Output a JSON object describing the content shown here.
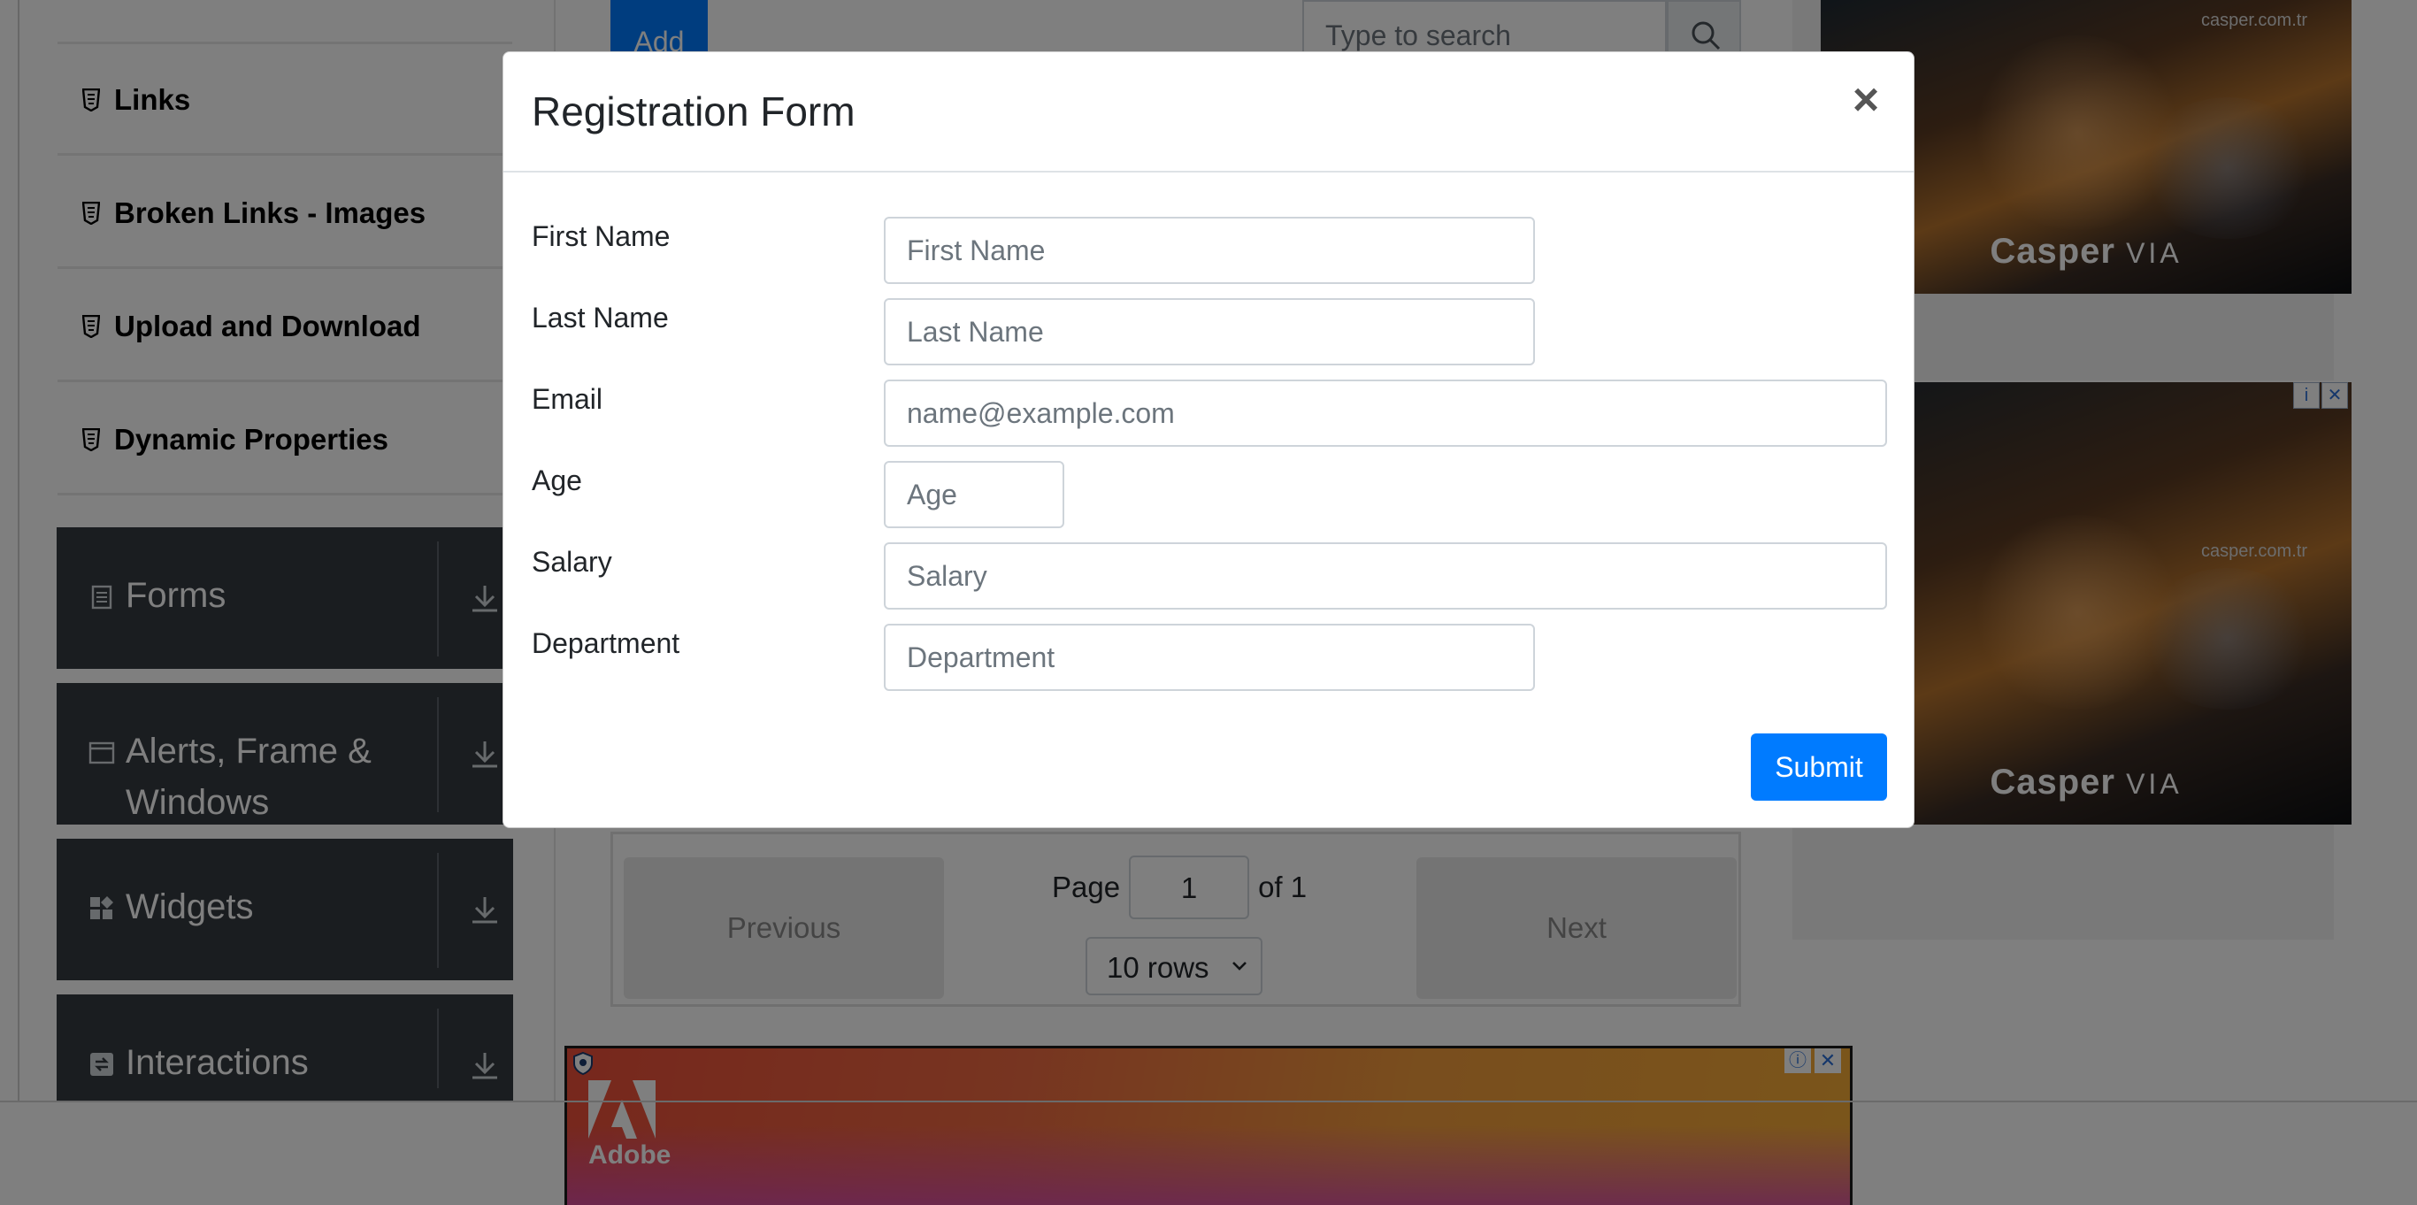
{
  "sidebar": {
    "element_items": [
      {
        "label": "Links"
      },
      {
        "label": "Broken Links - Images"
      },
      {
        "label": "Upload and Download"
      },
      {
        "label": "Dynamic Properties"
      }
    ],
    "groups": [
      {
        "label": "Forms",
        "icon": "form-icon"
      },
      {
        "label": "Alerts, Frame & Windows",
        "icon": "window-icon"
      },
      {
        "label": "Widgets",
        "icon": "widgets-icon"
      },
      {
        "label": "Interactions",
        "icon": "interactions-icon"
      }
    ]
  },
  "main": {
    "add_label": "Add",
    "search_placeholder": "Type to search",
    "pagination": {
      "previous_label": "Previous",
      "next_label": "Next",
      "page_label": "Page",
      "page_value": "1",
      "of_label": "of 1",
      "rows_selected": "10 rows"
    }
  },
  "ads": {
    "right_url": "casper.com.tr",
    "right_brand": "Casper",
    "right_brand_suffix": "VIA",
    "bottom_brand": "Adobe"
  },
  "modal": {
    "title": "Registration Form",
    "close_glyph": "×",
    "fields": [
      {
        "label": "First Name",
        "placeholder": "First Name"
      },
      {
        "label": "Last Name",
        "placeholder": "Last Name"
      },
      {
        "label": "Email",
        "placeholder": "name@example.com"
      },
      {
        "label": "Age",
        "placeholder": "Age"
      },
      {
        "label": "Salary",
        "placeholder": "Salary"
      },
      {
        "label": "Department",
        "placeholder": "Department"
      }
    ],
    "submit_label": "Submit"
  },
  "colors": {
    "primary": "#007bff",
    "sidebar_group_bg": "#343a40"
  }
}
